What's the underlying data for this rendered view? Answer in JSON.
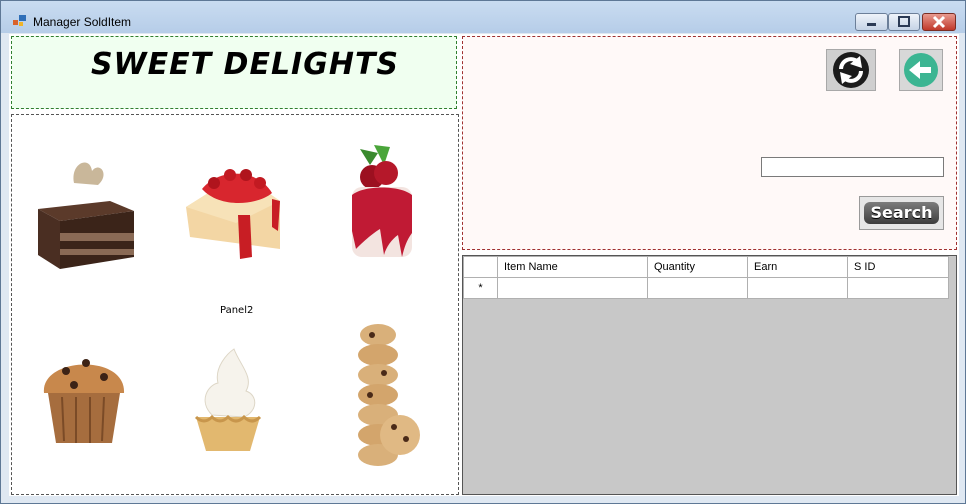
{
  "window": {
    "title": "Manager SoldItem"
  },
  "brand": {
    "title": "SWEET DELIGHTS"
  },
  "images_panel": {
    "caption": "Panel2",
    "items": [
      "chocolate-cake-slice",
      "cherry-cheesecake",
      "cherry-mousse",
      "chocolate-chip-muffin",
      "cream-tart",
      "cookie-stack"
    ]
  },
  "search_panel": {
    "search_value": "",
    "search_label": "Search",
    "refresh_icon": "refresh-icon",
    "back_icon": "back-arrow-icon"
  },
  "grid": {
    "columns": [
      "Item Name",
      "Quantity",
      "Earn",
      "S ID"
    ],
    "new_row_marker": "*",
    "rows": []
  },
  "colors": {
    "title_panel_bg": "#f0fff0",
    "search_panel_bg": "#fff9f8",
    "grid_bg": "#c8c8c8",
    "back_button": "#3cb592"
  }
}
